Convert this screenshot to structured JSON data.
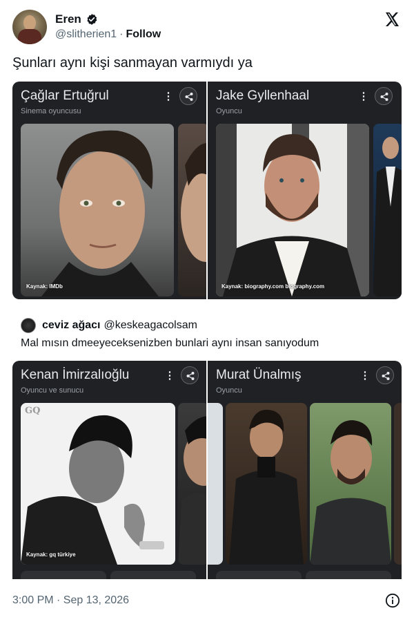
{
  "author": {
    "display_name": "Eren",
    "handle": "@slitherien1",
    "separator": "·",
    "follow_label": "Follow"
  },
  "tweet": {
    "text": "Şunları aynı kişi sanmayan varmıydı ya"
  },
  "cards_top": [
    {
      "title": "Çağlar Ertuğrul",
      "subtitle": "Sinema oyuncusu",
      "source": "Kaynak: IMDb"
    },
    {
      "title": "Jake Gyllenhaal",
      "subtitle": "Oyuncu",
      "source": "Kaynak: biography.com biography.com"
    }
  ],
  "quote": {
    "name": "ceviz ağacı",
    "handle": "@keskeagacolsam",
    "text": "Mal mısın dmeeyeceksenizben bunlari aynı insan sanıyodum"
  },
  "cards_bottom": [
    {
      "title": "Kenan İmirzalıoğlu",
      "subtitle": "Oyuncu ve sunucu",
      "source": "Kaynak: gq türkiye",
      "watermark": "GQ"
    },
    {
      "title": "Murat Ünalmış",
      "subtitle": "Oyuncu"
    }
  ],
  "footer": {
    "timestamp": "3:00 PM · Sep 13, 2026"
  },
  "colors": {
    "card_bg": "#202124",
    "text_secondary": "#536471"
  },
  "icons": [
    "verified-badge-icon",
    "x-logo-icon",
    "more-vert-icon",
    "share-icon",
    "info-icon"
  ]
}
